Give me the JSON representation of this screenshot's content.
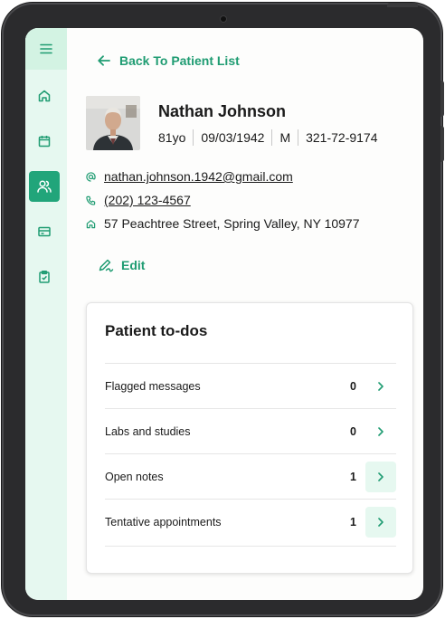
{
  "nav": {
    "back_label": "Back To Patient List",
    "items": [
      "home-icon",
      "calendar-icon",
      "users-icon",
      "billing-card-icon",
      "clipboard-icon"
    ],
    "active": "users-icon"
  },
  "patient": {
    "name": "Nathan Johnson",
    "age": "81yo",
    "dob": "09/03/1942",
    "sex": "M",
    "phone_id": "321-72-9174",
    "email": "nathan.johnson.1942@gmail.com",
    "phone": "(202) 123-4567",
    "address": "57 Peachtree Street, Spring Valley, NY 10977"
  },
  "actions": {
    "edit_label": "Edit"
  },
  "todos": {
    "title": "Patient to-dos",
    "rows": [
      {
        "label": "Flagged messages",
        "count": "0"
      },
      {
        "label": "Labs and studies",
        "count": "0"
      },
      {
        "label": "Open notes",
        "count": "1"
      },
      {
        "label": "Tentative appointments",
        "count": "1"
      }
    ]
  },
  "colors": {
    "accent": "#21a57a",
    "accent_text": "#1f9c72",
    "sidebar_bg": "#e6f8f0",
    "frame": "#2b2b2d"
  }
}
